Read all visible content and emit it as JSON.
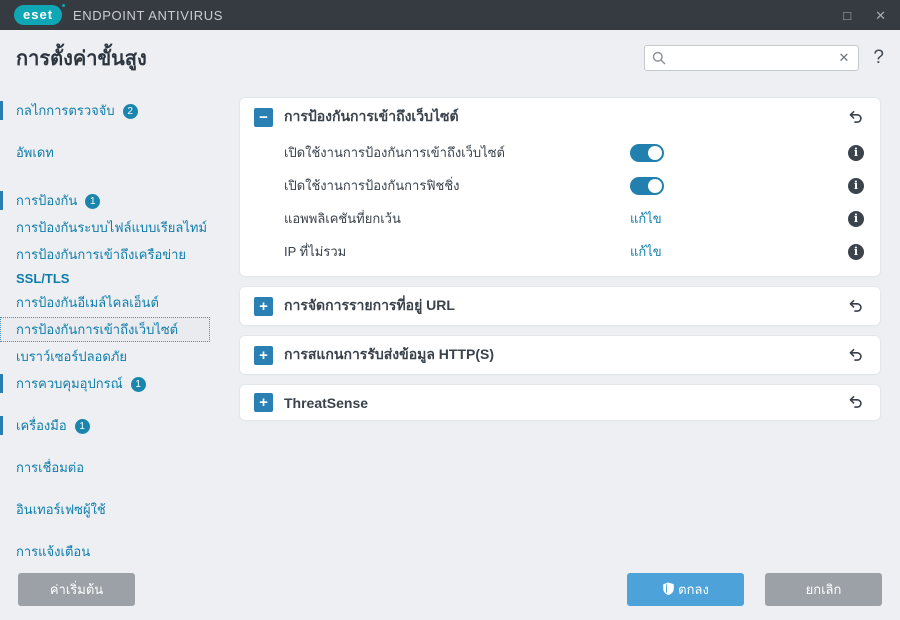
{
  "window": {
    "brand": "eset",
    "product": "ENDPOINT ANTIVIRUS",
    "maximize_glyph": "□",
    "close_glyph": "✕"
  },
  "header": {
    "page_title": "การตั้งค่าขั้นสูง",
    "search": {
      "value": "",
      "placeholder": "",
      "clear_glyph": "✕"
    },
    "help_glyph": "?"
  },
  "sidebar": {
    "items": [
      {
        "label": "กลไกการตรวจจับ",
        "badge": "2"
      },
      {
        "label": "อัพเดท"
      },
      {
        "label": "การป้องกัน",
        "badge": "1"
      },
      {
        "label": "การป้องกันระบบไฟล์แบบเรียลไทม์"
      },
      {
        "label": "การป้องกันการเข้าถึงเครือข่าย"
      },
      {
        "label": "SSL/TLS"
      },
      {
        "label": "การป้องกันอีเมล์ไคลเอ็นต์"
      },
      {
        "label": "การป้องกันการเข้าถึงเว็บไซต์",
        "selected": true
      },
      {
        "label": "เบราว์เซอร์ปลอดภัย"
      },
      {
        "label": "การควบคุมอุปกรณ์",
        "badge": "1"
      },
      {
        "label": "เครื่องมือ",
        "badge": "1"
      },
      {
        "label": "การเชื่อมต่อ"
      },
      {
        "label": "อินเทอร์เฟซผู้ใช้"
      },
      {
        "label": "การแจ้งเตือน"
      }
    ]
  },
  "content": {
    "sections": [
      {
        "title": "การป้องกันการเข้าถึงเว็บไซต์",
        "expanded": true,
        "collapse_glyph": "−",
        "rows": [
          {
            "label": "เปิดใช้งานการป้องกันการเข้าถึงเว็บไซต์",
            "control": "toggle",
            "state": "on"
          },
          {
            "label": "เปิดใช้งานการป้องกันการฟิชชิ่ง",
            "control": "toggle",
            "state": "on"
          },
          {
            "label": "แอพพลิเคชันที่ยกเว้น",
            "control": "link",
            "link": "แก้ไข"
          },
          {
            "label": "IP ที่ไม่รวม",
            "control": "link",
            "link": "แก้ไข"
          }
        ]
      },
      {
        "title": "การจัดการรายการที่อยู่ URL",
        "expanded": false,
        "expand_glyph": "+"
      },
      {
        "title": "การสแกนการรับส่งข้อมูล HTTP(S)",
        "expanded": false,
        "expand_glyph": "+"
      },
      {
        "title": "ThreatSense",
        "expanded": false,
        "expand_glyph": "+"
      }
    ],
    "info_glyph": "i"
  },
  "footer": {
    "default_label": "ค่าเริ่มต้น",
    "ok_label": "ตกลง",
    "cancel_label": "ยกเลิก"
  },
  "colors": {
    "titlebar": "#363b42",
    "logo_teal": "#0fa6b6",
    "sidebar_link": "#0f7dac",
    "accent_blue": "#2a80b2",
    "toggle_on": "#2180ae",
    "ok_button": "#4da3d9",
    "gray_button": "#9ba1a6",
    "badge": "#1b86ad"
  }
}
